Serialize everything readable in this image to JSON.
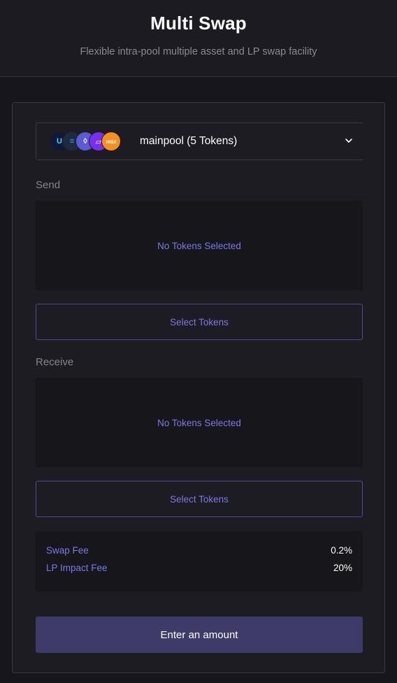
{
  "header": {
    "title": "Multi Swap",
    "subtitle": "Flexible intra-pool multiple asset and LP swap facility"
  },
  "pool": {
    "label": "mainpool (5 Tokens)",
    "token_icons": [
      {
        "name": "ultra-token-icon",
        "glyph": "U",
        "bg": "#0e1a3a",
        "fg": "#4fd2e8"
      },
      {
        "name": "equals-token-icon",
        "glyph": "≡",
        "bg": "#1e2b3e",
        "fg": "#3b9cff"
      },
      {
        "name": "eos-token-icon",
        "glyph": "◊",
        "bg": "#5b5bd6",
        "fg": "#ffffff"
      },
      {
        "name": "purple-token-icon",
        "glyph": "▱",
        "bg": "#7a2ff0",
        "fg": "#ffffff"
      },
      {
        "name": "wax-token-icon",
        "glyph": "wax",
        "bg": "#f78e1e",
        "fg": "#ffffff"
      }
    ]
  },
  "send": {
    "label": "Send",
    "empty_text": "No Tokens Selected",
    "select_label": "Select Tokens"
  },
  "receive": {
    "label": "Receive",
    "empty_text": "No Tokens Selected",
    "select_label": "Select Tokens"
  },
  "fees": {
    "swap_fee_label": "Swap Fee",
    "swap_fee_value": "0.2%",
    "lp_impact_label": "LP Impact Fee",
    "lp_impact_value": "20%"
  },
  "action": {
    "label": "Enter an amount"
  },
  "colors": {
    "accent": "#7b78e8",
    "button_bg": "#3e3b68",
    "background": "#17161c"
  }
}
